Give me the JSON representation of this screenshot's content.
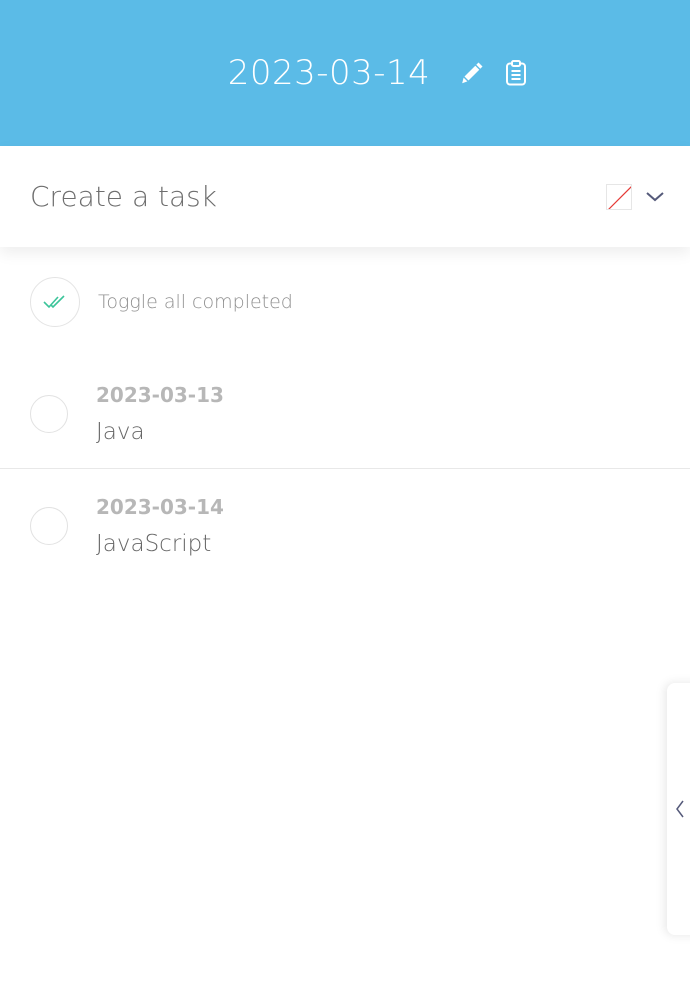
{
  "header": {
    "date": "2023-03-14",
    "background_color": "#5bbbe7",
    "edit_icon": "pencil-icon",
    "clipboard_icon": "clipboard-icon"
  },
  "create": {
    "placeholder": "Create a task",
    "color_swatch": "no-color",
    "dropdown_icon": "chevron-down-icon"
  },
  "toggle_all": {
    "label": "Toggle all completed",
    "icon": "double-check-icon",
    "icon_color": "#3cc49a"
  },
  "tasks": [
    {
      "date": "2023-03-13",
      "title": "Java",
      "completed": false
    },
    {
      "date": "2023-03-14",
      "title": "JavaScript",
      "completed": false
    }
  ],
  "drawer": {
    "icon": "chevron-left-icon"
  }
}
